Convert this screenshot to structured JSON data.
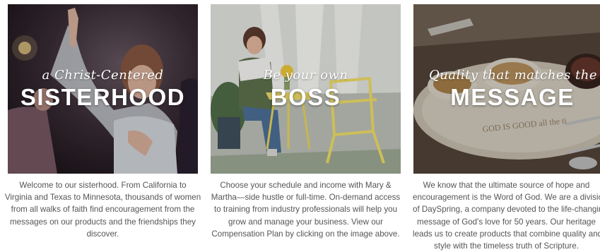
{
  "cards": [
    {
      "script_heading": "a Christ-Centered",
      "main_heading": "SISTERHOOD",
      "description_lines": [
        "Welcome to our sisterhood. From California to",
        "Virginia and Texas to Minnesota, thousands of women",
        "from all walks of faith find encouragement from the",
        "messages on our products and the friendships they",
        "discover."
      ]
    },
    {
      "script_heading": "Be your own",
      "main_heading": "BOSS",
      "description_lines": [
        "Choose your schedule and income with Mary &",
        "Martha—side hustle or full-time. On-demand access",
        "to training from industry professionals will help you",
        "grow and manage your business. View our",
        "Compensation Plan by clicking on the image above."
      ]
    },
    {
      "script_heading": "Quality that matches the",
      "main_heading": "MESSAGE",
      "image_text": "GOD IS GOOD all the ti",
      "description_lines": [
        "We know that the ultimate source of hope and",
        "encouragement is the Word of God. We are a division",
        "of DaySpring, a company devoted to the life-changing",
        "message of God's love for 50 years. Our heritage",
        "leads us to create products that combine quality and",
        "style with the timeless truth of Scripture."
      ]
    }
  ]
}
